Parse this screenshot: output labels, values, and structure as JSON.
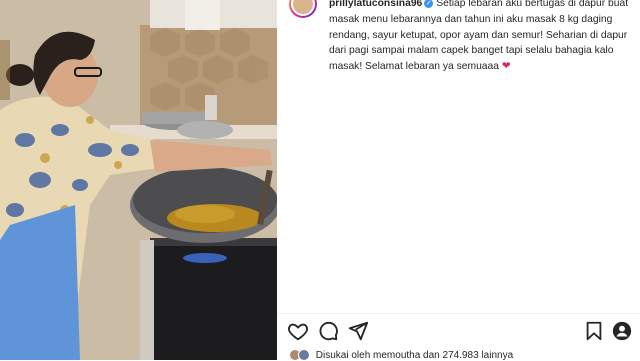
{
  "post": {
    "username": "prillylatuconsina96",
    "caption": "Setiap lebaran aku bertugas di dapur buat masak menu lebarannya dan tahun ini aku masak 8 kg daging rendang, sayur ketupat, opor ayam dan semur! Seharian di dapur dari pagi sampai malam capek banget tapi selalu bahagia kalo masak! Selamat lebaran ya semuaaa",
    "caption_emoji": "❤",
    "likes_text": "Disukai oleh memoutha dan 274.983 lainnya"
  },
  "icons": {
    "like": "heart-icon",
    "comment": "comment-icon",
    "share": "send-icon",
    "save": "bookmark-icon",
    "verified": "verified-badge-icon"
  },
  "colors": {
    "text": "#262626",
    "verified": "#3897f0",
    "heart": "#e0245e"
  }
}
